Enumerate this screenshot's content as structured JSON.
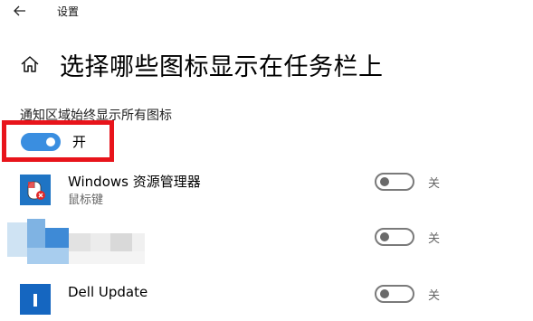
{
  "titlebar": {
    "back_icon": "back-arrow-icon",
    "title": "设置"
  },
  "header": {
    "home_icon": "home-icon",
    "title": "选择哪些图标显示在任务栏上"
  },
  "section": {
    "label": "通知区域始终显示所有图标"
  },
  "master_toggle": {
    "on": true,
    "state_label": "开",
    "highlight_color": "#e8141b",
    "accent_color": "#3a8ee0"
  },
  "apps": [
    {
      "name": "Windows 资源管理器",
      "subtitle": "鼠标键",
      "icon": "windows-explorer-mouse-icon",
      "on": false,
      "state_label": "关"
    },
    {
      "name": "",
      "subtitle": "",
      "icon": "blurred-app-icon",
      "on": false,
      "state_label": "关"
    },
    {
      "name": "Dell Update",
      "subtitle": "",
      "icon": "dell-update-icon",
      "on": false,
      "state_label": "关"
    }
  ]
}
